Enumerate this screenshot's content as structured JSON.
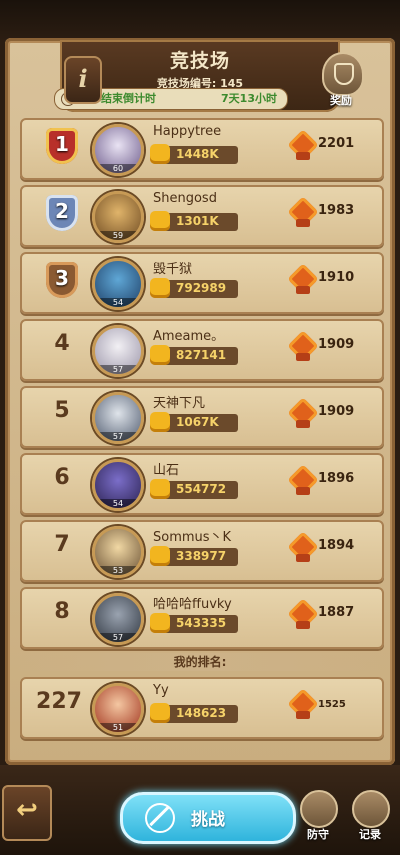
{
  "header": {
    "title": "竞技场",
    "arena_id": "竞技场编号: 145",
    "season_label": "赛季结束倒计时",
    "season_time": "7天13小时",
    "reward_label": "奖励"
  },
  "leaderboard": [
    {
      "rank": "1",
      "name": "Happytree",
      "power": "1448K",
      "score": "2201",
      "level": "60"
    },
    {
      "rank": "2",
      "name": "Shengosd",
      "power": "1301K",
      "score": "1983",
      "level": "59"
    },
    {
      "rank": "3",
      "name": "毁千狱",
      "power": "792989",
      "score": "1910",
      "level": "54"
    },
    {
      "rank": "4",
      "name": "Ameame。",
      "power": "827141",
      "score": "1909",
      "level": "57"
    },
    {
      "rank": "5",
      "name": "天神下凡",
      "power": "1067K",
      "score": "1909",
      "level": "57"
    },
    {
      "rank": "6",
      "name": "山石",
      "power": "554772",
      "score": "1896",
      "level": "54"
    },
    {
      "rank": "7",
      "name": "Sommus丶K",
      "power": "338977",
      "score": "1894",
      "level": "53"
    },
    {
      "rank": "8",
      "name": "哈哈哈ffuvky",
      "power": "543335",
      "score": "1887",
      "level": "57"
    }
  ],
  "my_rank": {
    "label": "我的排名:",
    "rank": "227",
    "name": "Yy",
    "power": "148623",
    "score": "1525",
    "level": "51"
  },
  "bottom": {
    "back_icon": "↩",
    "challenge_label": "挑战",
    "defense_label": "防守",
    "record_label": "记录"
  },
  "colors": {
    "gold": "#d4a43a",
    "silver": "#9fb0c9",
    "bronze": "#b0773e",
    "challenge": "#2fb4dc"
  }
}
